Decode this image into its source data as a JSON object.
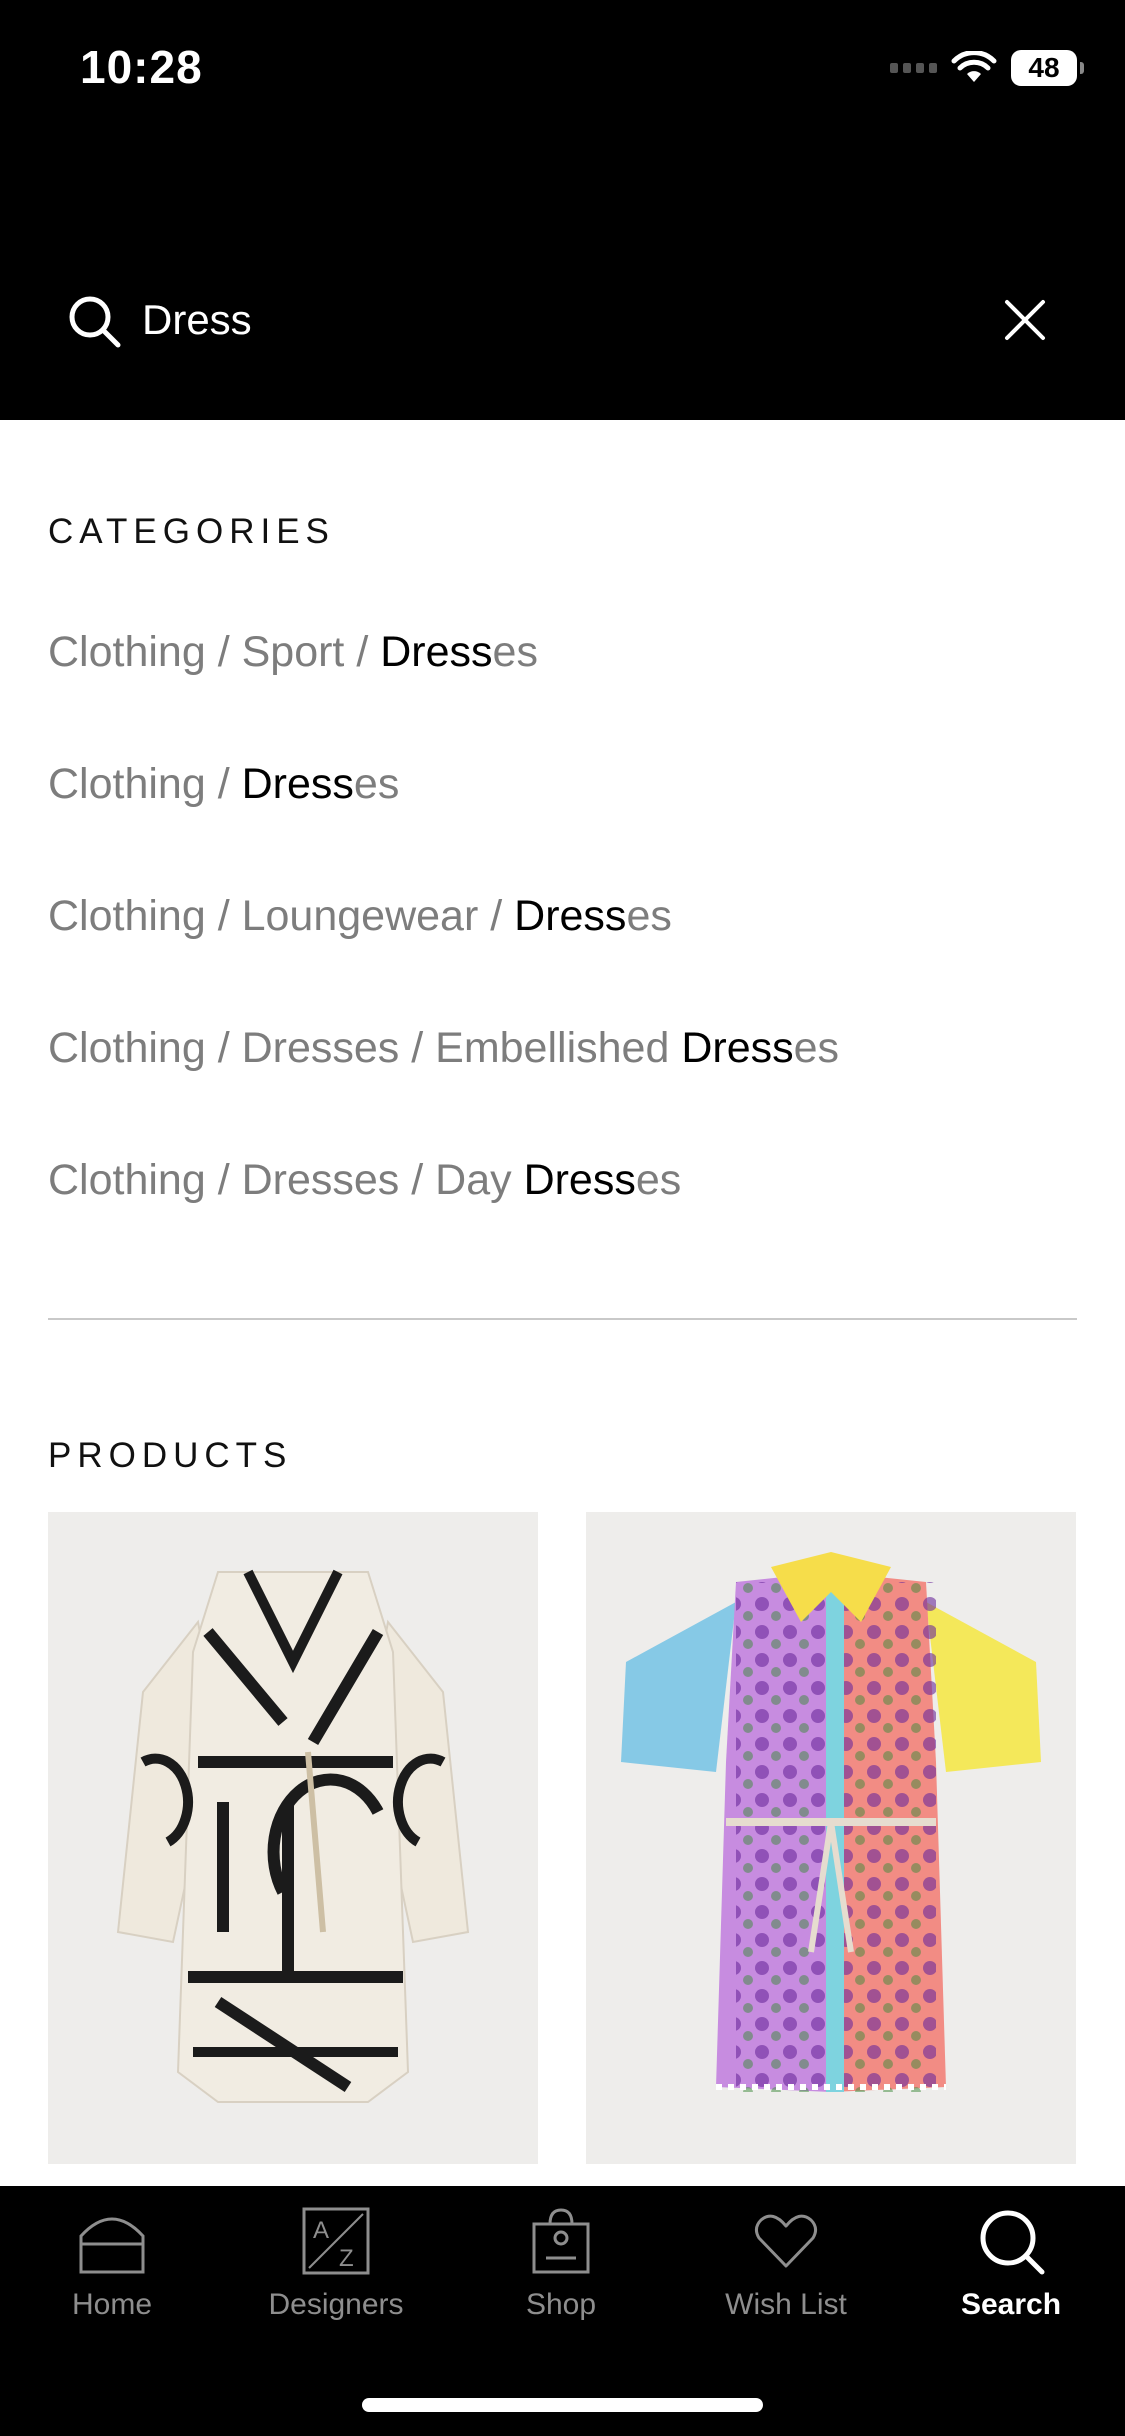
{
  "status_bar": {
    "time": "10:28",
    "battery": "48"
  },
  "search": {
    "query": "Dress",
    "placeholder": ""
  },
  "categories": {
    "heading": "CATEGORIES",
    "items": [
      {
        "prefix": "Clothing / Sport / ",
        "match": "Dress",
        "suffix": "es"
      },
      {
        "prefix": "Clothing / ",
        "match": "Dress",
        "suffix": "es"
      },
      {
        "prefix": "Clothing / Loungewear / ",
        "match": "Dress",
        "suffix": "es"
      },
      {
        "prefix": "Clothing / Dresses / Embellished ",
        "match": "Dress",
        "suffix": "es"
      },
      {
        "prefix": "Clothing / Dresses / Day ",
        "match": "Dress",
        "suffix": "es"
      }
    ]
  },
  "products": {
    "heading": "PRODUCTS",
    "items": [
      {
        "image": "monogram-print-wrap-dress"
      },
      {
        "image": "floral-patchwork-shirt-dress"
      }
    ]
  },
  "tabbar": {
    "tabs": [
      {
        "label": "Home",
        "icon": "home-icon",
        "active": false
      },
      {
        "label": "Designers",
        "icon": "designers-az-icon",
        "active": false
      },
      {
        "label": "Shop",
        "icon": "shop-bag-icon",
        "active": false
      },
      {
        "label": "Wish List",
        "icon": "heart-icon",
        "active": false
      },
      {
        "label": "Search",
        "icon": "search-icon",
        "active": true
      }
    ]
  },
  "colors": {
    "header_bg": "#000000",
    "muted_text": "#7d7d7d",
    "active_tab": "#ffffff",
    "inactive_tab": "#8e8e8e"
  }
}
